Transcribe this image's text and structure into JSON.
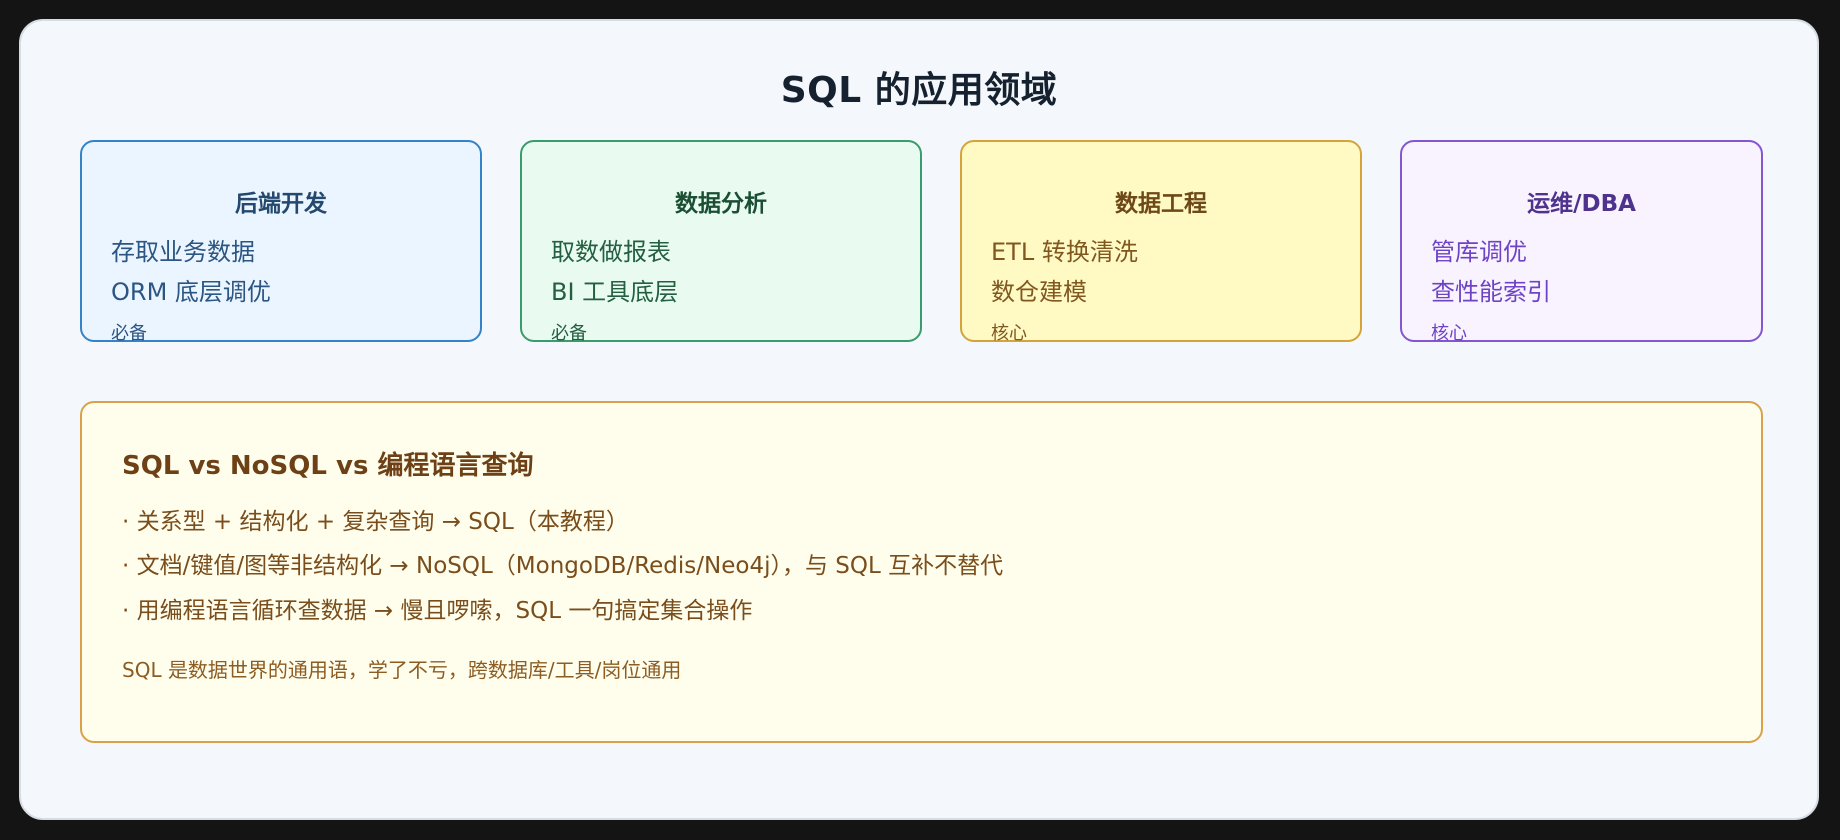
{
  "title": "SQL 的应用领域",
  "cards": [
    {
      "title": "后端开发",
      "lines": [
        "存取业务数据",
        "ORM 底层调优"
      ],
      "tag": "必备"
    },
    {
      "title": "数据分析",
      "lines": [
        "取数做报表",
        "BI 工具底层"
      ],
      "tag": "必备"
    },
    {
      "title": "数据工程",
      "lines": [
        "ETL 转换清洗",
        "数仓建模"
      ],
      "tag": "核心"
    },
    {
      "title": "运维/DBA",
      "lines": [
        "管库调优",
        "查性能索引"
      ],
      "tag": "核心"
    }
  ],
  "compare": {
    "title": "SQL vs NoSQL vs 编程语言查询",
    "items": [
      "· 关系型 + 结构化 + 复杂查询 → SQL（本教程）",
      "· 文档/键值/图等非结构化 → NoSQL（MongoDB/Redis/Neo4j），与 SQL 互补不替代",
      "· 用编程语言循环查数据 → 慢且啰嗦，SQL 一句搞定集合操作"
    ],
    "note": "SQL 是数据世界的通用语，学了不亏，跨数据库/工具/岗位通用"
  },
  "colors": {
    "backend_border": "#3483c8",
    "analysis_border": "#3a9c6c",
    "engineering_border": "#d4a43a",
    "dba_border": "#8456d0",
    "compare_border": "#d9a24a"
  }
}
